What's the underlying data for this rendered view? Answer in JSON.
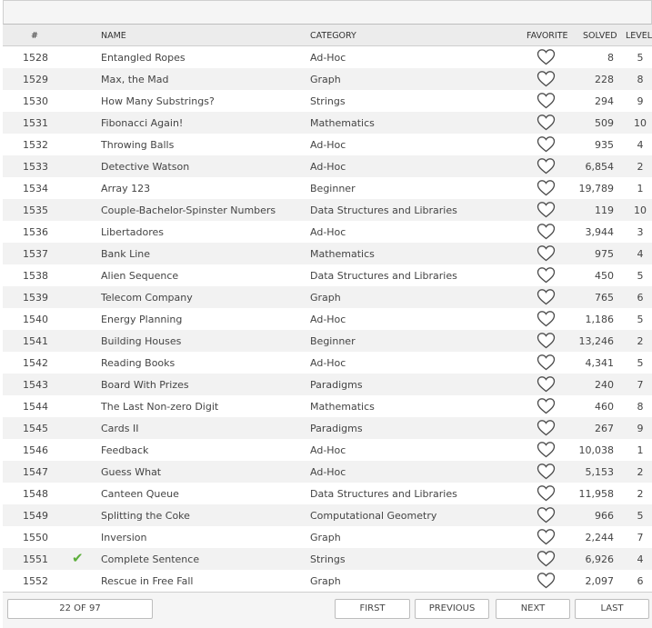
{
  "header": {
    "num": "#",
    "name": "NAME",
    "category": "CATEGORY",
    "favorite": "FAVORITE",
    "solved": "SOLVED",
    "level": "LEVEL"
  },
  "icons": {
    "favorite": "heart-outline-icon",
    "solved_check": "check-icon"
  },
  "colors": {
    "check": "#5cae3b",
    "alt_row": "#f2f2f2"
  },
  "rows": [
    {
      "num": "1528",
      "check": "",
      "name": "Entangled Ropes",
      "category": "Ad-Hoc",
      "solved": "8",
      "level": "5"
    },
    {
      "num": "1529",
      "check": "",
      "name": "Max, the Mad",
      "category": "Graph",
      "solved": "228",
      "level": "8"
    },
    {
      "num": "1530",
      "check": "",
      "name": "How Many Substrings?",
      "category": "Strings",
      "solved": "294",
      "level": "9"
    },
    {
      "num": "1531",
      "check": "",
      "name": "Fibonacci Again!",
      "category": "Mathematics",
      "solved": "509",
      "level": "10"
    },
    {
      "num": "1532",
      "check": "",
      "name": "Throwing Balls",
      "category": "Ad-Hoc",
      "solved": "935",
      "level": "4"
    },
    {
      "num": "1533",
      "check": "",
      "name": "Detective Watson",
      "category": "Ad-Hoc",
      "solved": "6,854",
      "level": "2"
    },
    {
      "num": "1534",
      "check": "",
      "name": "Array 123",
      "category": "Beginner",
      "solved": "19,789",
      "level": "1"
    },
    {
      "num": "1535",
      "check": "",
      "name": "Couple-Bachelor-Spinster Numbers",
      "category": "Data Structures and Libraries",
      "solved": "119",
      "level": "10"
    },
    {
      "num": "1536",
      "check": "",
      "name": "Libertadores",
      "category": "Ad-Hoc",
      "solved": "3,944",
      "level": "3"
    },
    {
      "num": "1537",
      "check": "",
      "name": "Bank Line",
      "category": "Mathematics",
      "solved": "975",
      "level": "4"
    },
    {
      "num": "1538",
      "check": "",
      "name": "Alien Sequence",
      "category": "Data Structures and Libraries",
      "solved": "450",
      "level": "5"
    },
    {
      "num": "1539",
      "check": "",
      "name": "Telecom Company",
      "category": "Graph",
      "solved": "765",
      "level": "6"
    },
    {
      "num": "1540",
      "check": "",
      "name": "Energy Planning",
      "category": "Ad-Hoc",
      "solved": "1,186",
      "level": "5"
    },
    {
      "num": "1541",
      "check": "",
      "name": "Building Houses",
      "category": "Beginner",
      "solved": "13,246",
      "level": "2"
    },
    {
      "num": "1542",
      "check": "",
      "name": "Reading Books",
      "category": "Ad-Hoc",
      "solved": "4,341",
      "level": "5"
    },
    {
      "num": "1543",
      "check": "",
      "name": "Board With Prizes",
      "category": "Paradigms",
      "solved": "240",
      "level": "7"
    },
    {
      "num": "1544",
      "check": "",
      "name": "The Last Non-zero Digit",
      "category": "Mathematics",
      "solved": "460",
      "level": "8"
    },
    {
      "num": "1545",
      "check": "",
      "name": "Cards II",
      "category": "Paradigms",
      "solved": "267",
      "level": "9"
    },
    {
      "num": "1546",
      "check": "",
      "name": "Feedback",
      "category": "Ad-Hoc",
      "solved": "10,038",
      "level": "1"
    },
    {
      "num": "1547",
      "check": "",
      "name": "Guess What",
      "category": "Ad-Hoc",
      "solved": "5,153",
      "level": "2"
    },
    {
      "num": "1548",
      "check": "",
      "name": "Canteen Queue",
      "category": "Data Structures and Libraries",
      "solved": "11,958",
      "level": "2"
    },
    {
      "num": "1549",
      "check": "",
      "name": "Splitting the Coke",
      "category": "Computational Geometry",
      "solved": "966",
      "level": "5"
    },
    {
      "num": "1550",
      "check": "",
      "name": "Inversion",
      "category": "Graph",
      "solved": "2,244",
      "level": "7"
    },
    {
      "num": "1551",
      "check": "✔",
      "name": "Complete Sentence",
      "category": "Strings",
      "solved": "6,926",
      "level": "4"
    },
    {
      "num": "1552",
      "check": "",
      "name": "Rescue in Free Fall",
      "category": "Graph",
      "solved": "2,097",
      "level": "6"
    }
  ],
  "pagination": {
    "page_info": "22 OF 97",
    "first": "FIRST",
    "previous": "PREVIOUS",
    "next": "NEXT",
    "last": "LAST"
  }
}
